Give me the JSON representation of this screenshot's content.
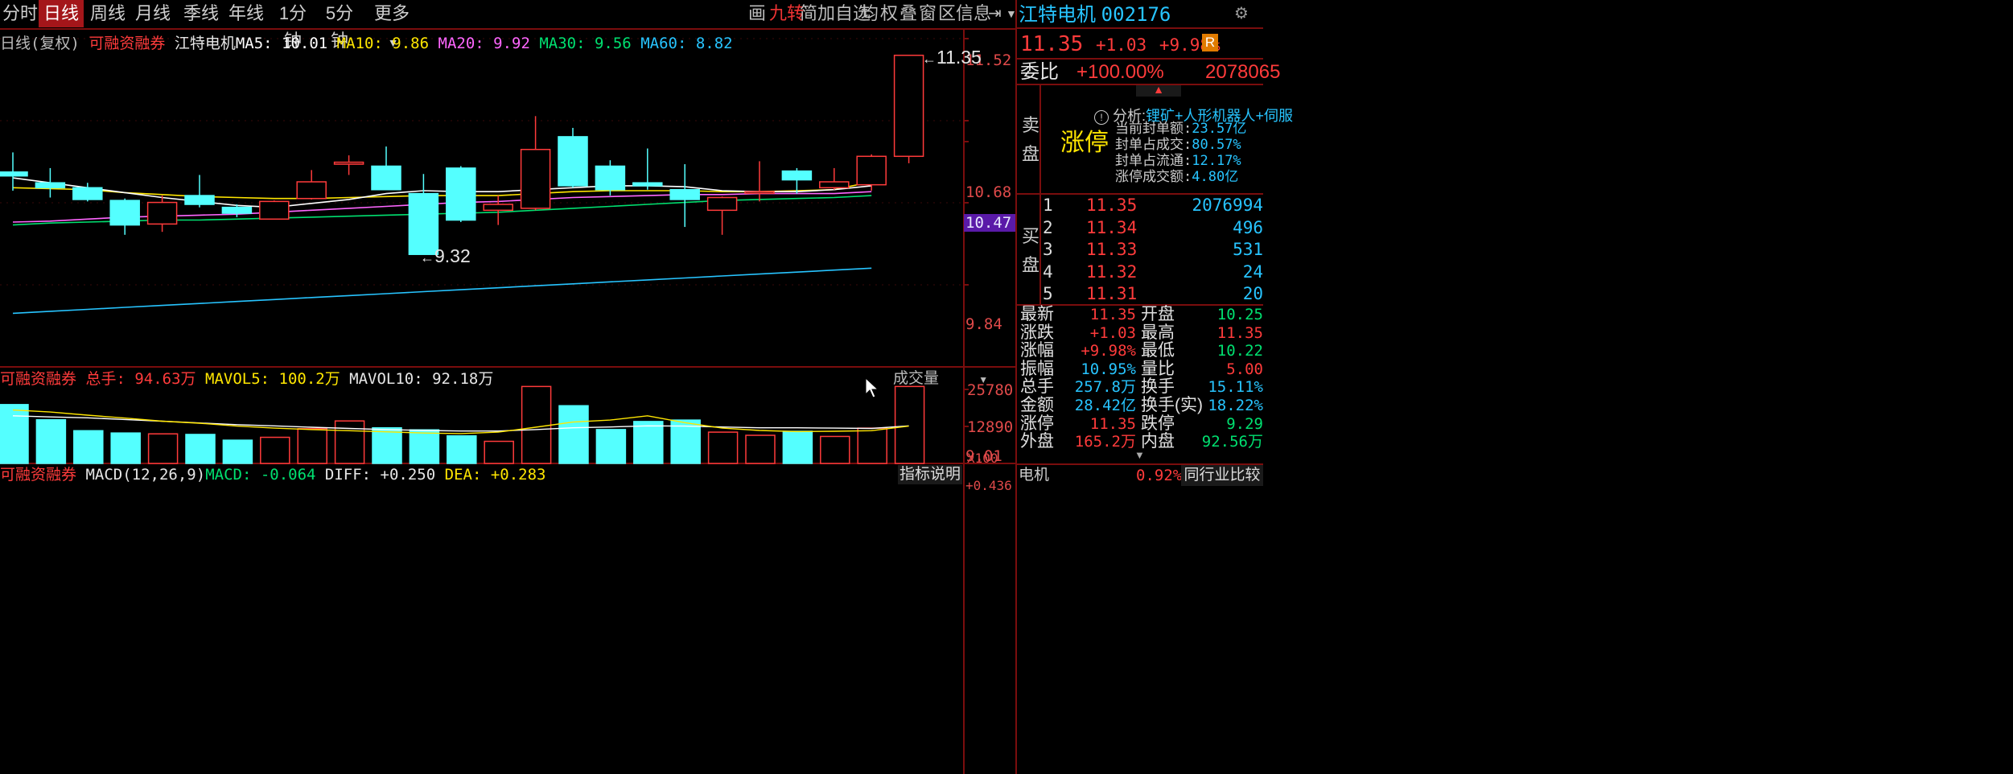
{
  "tabs": [
    "分时",
    "日线",
    "周线",
    "月线",
    "季线",
    "年线",
    "1分钟",
    "5分钟",
    "更多"
  ],
  "active_tab": "日线",
  "toolbar": [
    "画",
    "九转",
    "简",
    "加自选",
    "均",
    "权",
    "叠",
    "窗",
    "区",
    "信息"
  ],
  "toolbar_highlight": "九转",
  "toolbar_icons": [
    "exit-icon",
    "triangle-menu-icon"
  ],
  "stock": {
    "name": "江特电机",
    "code": "002176",
    "price": "11.35",
    "change": "+1.03",
    "change_pct": "+9.98%",
    "badge": "R"
  },
  "ma_legend": {
    "period": "日线(复权)",
    "tag": "可融资融券",
    "name": "江特电机",
    "items": [
      {
        "label": "MA5: 10.01",
        "color": "#ffffff"
      },
      {
        "label": "MA10: 9.86",
        "color": "#ffe600"
      },
      {
        "label": "MA20: 9.92",
        "color": "#ff66ff"
      },
      {
        "label": "MA30: 9.56",
        "color": "#00e070"
      },
      {
        "label": "MA60: 8.82",
        "color": "#27c4ff"
      }
    ]
  },
  "price_axis": [
    "11.52",
    "10.68",
    "10.47",
    "9.84",
    "9.01"
  ],
  "price_marker": "10.47",
  "annotations": {
    "high": "11.35",
    "low": "9.32"
  },
  "candles": [
    {
      "o": 10.16,
      "c": 10.12,
      "h": 10.36,
      "l": 9.97
    },
    {
      "o": 10.05,
      "c": 10.0,
      "h": 10.2,
      "l": 9.9
    },
    {
      "o": 10.0,
      "c": 9.88,
      "h": 10.05,
      "l": 9.86
    },
    {
      "o": 9.87,
      "c": 9.62,
      "h": 9.89,
      "l": 9.52
    },
    {
      "o": 9.63,
      "c": 9.85,
      "h": 9.92,
      "l": 9.55
    },
    {
      "o": 9.92,
      "c": 9.83,
      "h": 10.13,
      "l": 9.8
    },
    {
      "o": 9.8,
      "c": 9.74,
      "h": 9.83,
      "l": 9.7
    },
    {
      "o": 9.68,
      "c": 9.86,
      "h": 9.87,
      "l": 9.68
    },
    {
      "o": 9.89,
      "c": 10.06,
      "h": 10.18,
      "l": 9.88
    },
    {
      "o": 10.24,
      "c": 10.26,
      "h": 10.33,
      "l": 10.13
    },
    {
      "o": 10.22,
      "c": 9.98,
      "h": 10.42,
      "l": 9.98
    },
    {
      "o": 9.94,
      "c": 9.32,
      "h": 10.14,
      "l": 9.32
    },
    {
      "o": 10.2,
      "c": 9.67,
      "h": 10.22,
      "l": 9.65
    },
    {
      "o": 9.77,
      "c": 9.83,
      "h": 9.92,
      "l": 9.62
    },
    {
      "o": 9.79,
      "c": 10.39,
      "h": 10.73,
      "l": 9.77
    },
    {
      "o": 10.52,
      "c": 10.02,
      "h": 10.61,
      "l": 10.0
    },
    {
      "o": 10.22,
      "c": 9.98,
      "h": 10.28,
      "l": 9.92
    },
    {
      "o": 10.05,
      "c": 10.02,
      "h": 10.4,
      "l": 9.98
    },
    {
      "o": 9.98,
      "c": 9.88,
      "h": 10.24,
      "l": 9.6
    },
    {
      "o": 9.77,
      "c": 9.9,
      "h": 9.91,
      "l": 9.52
    },
    {
      "o": 9.95,
      "c": 9.96,
      "h": 10.27,
      "l": 9.86
    },
    {
      "o": 10.17,
      "c": 10.08,
      "h": 10.2,
      "l": 9.94
    },
    {
      "o": 10.0,
      "c": 10.06,
      "h": 10.2,
      "l": 9.98
    },
    {
      "o": 10.03,
      "c": 10.32,
      "h": 10.34,
      "l": 9.97
    },
    {
      "o": 10.32,
      "c": 11.35,
      "h": 11.35,
      "l": 10.25
    }
  ],
  "ma_lines": {
    "ma5": [
      10.1,
      10.05,
      10.0,
      9.95,
      9.9,
      9.86,
      9.82,
      9.8,
      9.84,
      9.88,
      9.94,
      9.97,
      9.96,
      9.96,
      9.98,
      10.0,
      10.02,
      10.02,
      10.01,
      9.97,
      9.96,
      9.96,
      9.98,
      10.02,
      10.01
    ],
    "ma10": [
      10.0,
      9.99,
      9.98,
      9.95,
      9.93,
      9.91,
      9.9,
      9.89,
      9.89,
      9.9,
      9.91,
      9.92,
      9.92,
      9.92,
      9.94,
      9.96,
      9.97,
      9.97,
      9.97,
      9.96,
      9.96,
      9.97,
      9.98,
      10.06,
      9.86
    ],
    "ma20": [
      9.65,
      9.66,
      9.68,
      9.7,
      9.71,
      9.72,
      9.73,
      9.75,
      9.77,
      9.79,
      9.81,
      9.83,
      9.85,
      9.86,
      9.88,
      9.9,
      9.91,
      9.92,
      9.93,
      9.93,
      9.94,
      9.94,
      9.94,
      9.96,
      9.92
    ],
    "ma30": [
      9.62,
      9.64,
      9.65,
      9.66,
      9.67,
      9.67,
      9.68,
      9.69,
      9.7,
      9.71,
      9.72,
      9.73,
      9.74,
      9.75,
      9.77,
      9.79,
      9.81,
      9.83,
      9.85,
      9.87,
      9.88,
      9.89,
      9.9,
      9.92,
      9.56
    ],
    "ma60": [
      8.72,
      8.74,
      8.76,
      8.78,
      8.8,
      8.82,
      8.84,
      8.86,
      8.88,
      8.9,
      8.92,
      8.94,
      8.96,
      8.98,
      9.0,
      9.02,
      9.04,
      9.06,
      9.08,
      9.1,
      9.12,
      9.14,
      9.16,
      9.18,
      8.82
    ]
  },
  "volume_legend": {
    "tag": "可融资融券",
    "total": "总手: 94.63万",
    "mavol5": "MAVOL5: 100.2万",
    "mavol10": "MAVOL10: 92.18万",
    "selector": "成交量"
  },
  "volume_axis": [
    "25780",
    "12890",
    "X100"
  ],
  "volumes": [
    20500,
    15200,
    11400,
    10600,
    10300,
    10100,
    8100,
    9100,
    12100,
    14800,
    12400,
    11700,
    9600,
    7700,
    26800,
    20100,
    11800,
    14600,
    15100,
    10900,
    9800,
    11200,
    9400,
    12300,
    26800
  ],
  "vol_ma5": [
    18600,
    17900,
    16800,
    15800,
    14700,
    14000,
    13000,
    12300,
    11800,
    11400,
    11000,
    10600,
    10400,
    10900,
    12600,
    14400,
    15100,
    16600,
    14200,
    12300,
    11500,
    11100,
    11200,
    11400,
    13000
  ],
  "vol_ma10": [
    16600,
    16200,
    15900,
    15300,
    14700,
    14100,
    13500,
    13100,
    12600,
    12200,
    11800,
    11500,
    11300,
    11300,
    11800,
    12400,
    12700,
    13100,
    13000,
    12700,
    12400,
    12400,
    12300,
    12200,
    13100
  ],
  "macd_legend": {
    "tag": "可融资融券",
    "params": "MACD(12,26,9)",
    "macd": "MACD: -0.064",
    "diff": "DIFF: +0.250",
    "dea": "DEA: +0.283",
    "button": "指标说明"
  },
  "macd_axis": "+0.436",
  "orderbook": {
    "ratio_label": "委比",
    "ratio": "+100.00%",
    "ratio_vol": "2078065",
    "sell_label": [
      "卖",
      "盘"
    ],
    "buy_label": [
      "买",
      "盘"
    ],
    "limit_status": "涨停",
    "analysis_label": "分析:",
    "analysis": "锂矿+人形机器人+伺服",
    "limit_info": [
      {
        "label": "当前封单额:",
        "value": "23.57亿"
      },
      {
        "label": "封单占成交:",
        "value": "80.57%"
      },
      {
        "label": "封单占流通:",
        "value": "12.17%"
      },
      {
        "label": "涨停成交额:",
        "value": "4.80亿"
      }
    ],
    "bids": [
      {
        "level": "1",
        "price": "11.35",
        "vol": "2076994"
      },
      {
        "level": "2",
        "price": "11.34",
        "vol": "496"
      },
      {
        "level": "3",
        "price": "11.33",
        "vol": "531"
      },
      {
        "level": "4",
        "price": "11.32",
        "vol": "24"
      },
      {
        "level": "5",
        "price": "11.31",
        "vol": "20"
      }
    ]
  },
  "quote": [
    {
      "l1": "最新",
      "v1": "11.35",
      "c1": "red",
      "l2": "开盘",
      "v2": "10.25",
      "c2": "green"
    },
    {
      "l1": "涨跌",
      "v1": "+1.03",
      "c1": "red",
      "l2": "最高",
      "v2": "11.35",
      "c2": "red"
    },
    {
      "l1": "涨幅",
      "v1": "+9.98%",
      "c1": "red",
      "l2": "最低",
      "v2": "10.22",
      "c2": "green"
    },
    {
      "l1": "振幅",
      "v1": "10.95%",
      "c1": "cyan",
      "l2": "量比",
      "v2": "5.00",
      "c2": "red"
    },
    {
      "l1": "总手",
      "v1": "257.8万",
      "c1": "cyan",
      "l2": "换手",
      "v2": "15.11%",
      "c2": "cyan"
    },
    {
      "l1": "金额",
      "v1": "28.42亿",
      "c1": "cyan",
      "l2": "换手(实)",
      "v2": "18.22%",
      "c2": "cyan"
    },
    {
      "l1": "涨停",
      "v1": "11.35",
      "c1": "red",
      "l2": "跌停",
      "v2": "9.29",
      "c2": "green"
    },
    {
      "l1": "外盘",
      "v1": "165.2万",
      "c1": "red",
      "l2": "内盘",
      "v2": "92.56万",
      "c2": "green"
    }
  ],
  "footer": {
    "sector": "电机",
    "sector_pct": "0.92%",
    "compare": "同行业比较"
  },
  "colors": {
    "up": "#ff3b3b",
    "down": "#54ffff",
    "axis": "#7a0d0d"
  }
}
